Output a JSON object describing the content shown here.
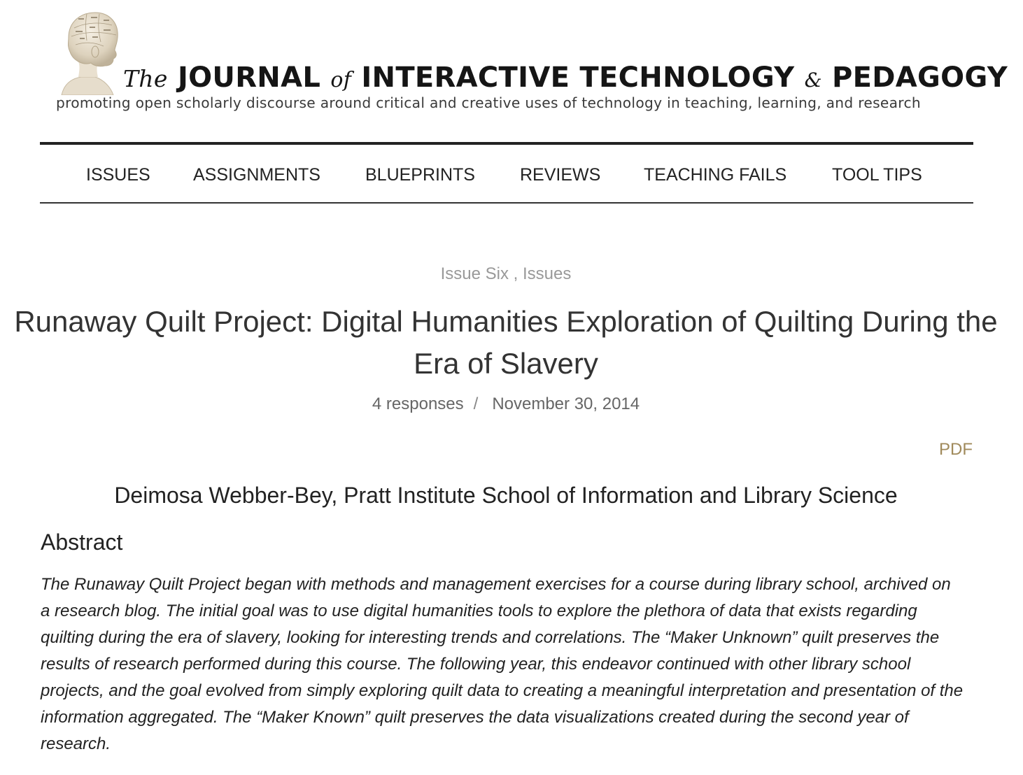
{
  "masthead": {
    "title_the": "The",
    "title_journal": "JOURNAL",
    "title_of": "of",
    "title_interactive_technology": "INTERACTIVE TECHNOLOGY",
    "title_amp": "&",
    "title_pedagogy": "PEDAGOGY",
    "tagline": "promoting open scholarly discourse around critical and creative uses of technology in teaching, learning, and research",
    "logo_icon": "phrenology-head-icon"
  },
  "nav": {
    "items": [
      {
        "label": "ISSUES"
      },
      {
        "label": "ASSIGNMENTS"
      },
      {
        "label": "BLUEPRINTS"
      },
      {
        "label": "REVIEWS"
      },
      {
        "label": "TEACHING FAILS"
      },
      {
        "label": "TOOL TIPS"
      }
    ]
  },
  "article": {
    "categories": [
      "Issue Six",
      "Issues"
    ],
    "category_separator": " , ",
    "title": "Runaway Quilt Project: Digital Humanities Exploration of Quilting During the Era of Slavery",
    "responses": "4 responses",
    "meta_separator": "/",
    "date": "November 30, 2014",
    "pdf_label": "PDF",
    "author": "Deimosa Webber-Bey, Pratt Institute School of Information and Library Science",
    "abstract_heading": "Abstract",
    "abstract_text": "The Runaway Quilt Project began with methods and management exercises for a course during library school, archived on a research blog. The initial goal was to use digital humanities tools to explore the plethora of data that exists regarding quilting during the era of slavery, looking for interesting trends and correlations. The “Maker Unknown” quilt preserves the results of research performed during this course. The following year, this endeavor continued with other library school projects, and the goal evolved from simply exploring quilt data to creating a meaningful interpretation and presentation of the information aggregated. The “Maker Known” quilt preserves the data visualizations created during the second year of research."
  },
  "colors": {
    "link_gold": "#a08a5b",
    "muted_gray": "#999999",
    "text_dark": "#222222"
  }
}
